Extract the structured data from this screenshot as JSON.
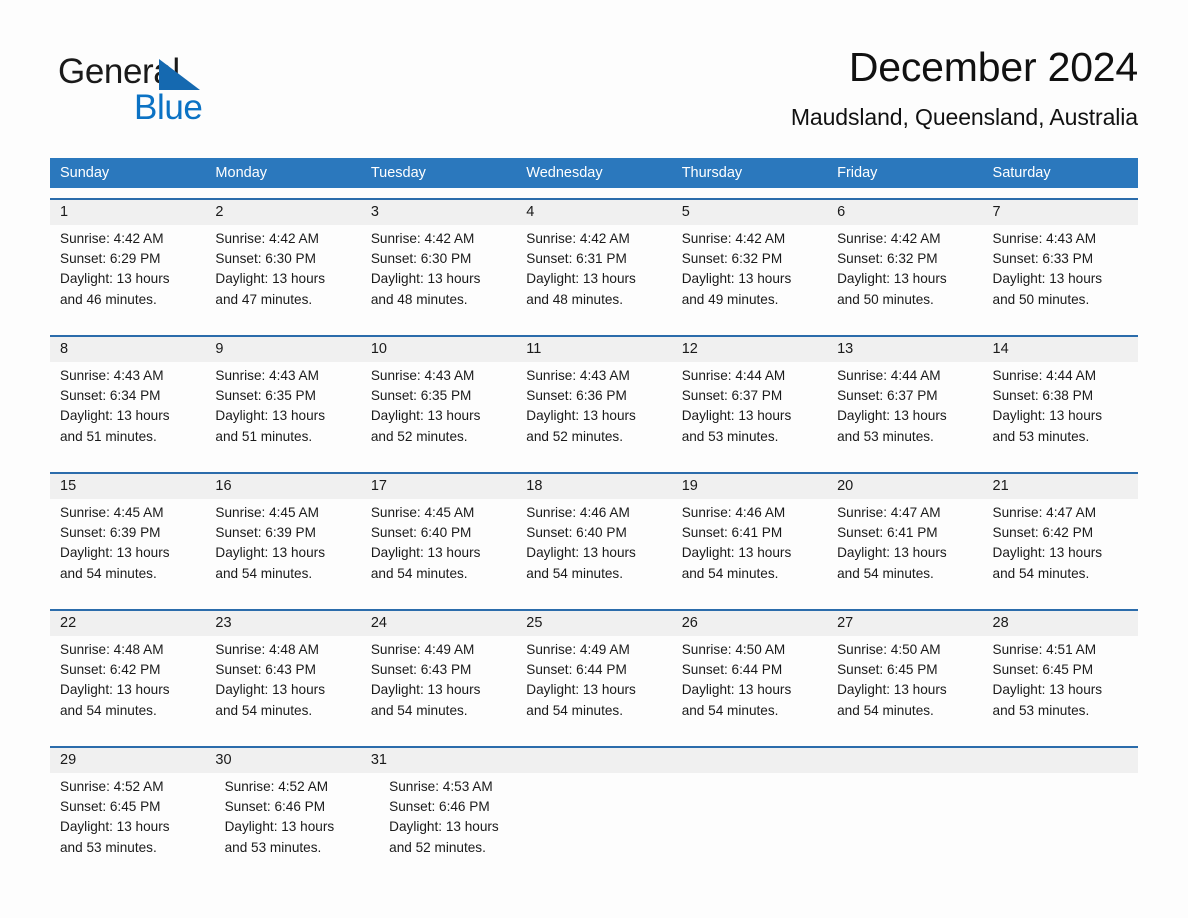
{
  "brand": {
    "name_part1": "General",
    "name_part2": "Blue",
    "triangle_color": "#1569b0",
    "blue_color": "#0b72c4"
  },
  "header": {
    "title": "December 2024",
    "location": "Maudsland, Queensland, Australia"
  },
  "theme": {
    "header_bg": "#2b78bd",
    "row_rule": "#2b6cab",
    "date_strip_bg": "#f0f0f0",
    "page_bg": "#fdfdfd",
    "text": "#1a1a1a"
  },
  "weekdays": [
    "Sunday",
    "Monday",
    "Tuesday",
    "Wednesday",
    "Thursday",
    "Friday",
    "Saturday"
  ],
  "weeks": [
    {
      "days": [
        {
          "date": "1",
          "l1": "Sunrise: 4:42 AM",
          "l2": "Sunset: 6:29 PM",
          "l3": "Daylight: 13 hours",
          "l4": "and 46 minutes."
        },
        {
          "date": "2",
          "l1": "Sunrise: 4:42 AM",
          "l2": "Sunset: 6:30 PM",
          "l3": "Daylight: 13 hours",
          "l4": "and 47 minutes."
        },
        {
          "date": "3",
          "l1": "Sunrise: 4:42 AM",
          "l2": "Sunset: 6:30 PM",
          "l3": "Daylight: 13 hours",
          "l4": "and 48 minutes."
        },
        {
          "date": "4",
          "l1": "Sunrise: 4:42 AM",
          "l2": "Sunset: 6:31 PM",
          "l3": "Daylight: 13 hours",
          "l4": "and 48 minutes."
        },
        {
          "date": "5",
          "l1": "Sunrise: 4:42 AM",
          "l2": "Sunset: 6:32 PM",
          "l3": "Daylight: 13 hours",
          "l4": "and 49 minutes."
        },
        {
          "date": "6",
          "l1": "Sunrise: 4:42 AM",
          "l2": "Sunset: 6:32 PM",
          "l3": "Daylight: 13 hours",
          "l4": "and 50 minutes."
        },
        {
          "date": "7",
          "l1": "Sunrise: 4:43 AM",
          "l2": "Sunset: 6:33 PM",
          "l3": "Daylight: 13 hours",
          "l4": "and 50 minutes."
        }
      ]
    },
    {
      "days": [
        {
          "date": "8",
          "l1": "Sunrise: 4:43 AM",
          "l2": "Sunset: 6:34 PM",
          "l3": "Daylight: 13 hours",
          "l4": "and 51 minutes."
        },
        {
          "date": "9",
          "l1": "Sunrise: 4:43 AM",
          "l2": "Sunset: 6:35 PM",
          "l3": "Daylight: 13 hours",
          "l4": "and 51 minutes."
        },
        {
          "date": "10",
          "l1": "Sunrise: 4:43 AM",
          "l2": "Sunset: 6:35 PM",
          "l3": "Daylight: 13 hours",
          "l4": "and 52 minutes."
        },
        {
          "date": "11",
          "l1": "Sunrise: 4:43 AM",
          "l2": "Sunset: 6:36 PM",
          "l3": "Daylight: 13 hours",
          "l4": "and 52 minutes."
        },
        {
          "date": "12",
          "l1": "Sunrise: 4:44 AM",
          "l2": "Sunset: 6:37 PM",
          "l3": "Daylight: 13 hours",
          "l4": "and 53 minutes."
        },
        {
          "date": "13",
          "l1": "Sunrise: 4:44 AM",
          "l2": "Sunset: 6:37 PM",
          "l3": "Daylight: 13 hours",
          "l4": "and 53 minutes."
        },
        {
          "date": "14",
          "l1": "Sunrise: 4:44 AM",
          "l2": "Sunset: 6:38 PM",
          "l3": "Daylight: 13 hours",
          "l4": "and 53 minutes."
        }
      ]
    },
    {
      "days": [
        {
          "date": "15",
          "l1": "Sunrise: 4:45 AM",
          "l2": "Sunset: 6:39 PM",
          "l3": "Daylight: 13 hours",
          "l4": "and 54 minutes."
        },
        {
          "date": "16",
          "l1": "Sunrise: 4:45 AM",
          "l2": "Sunset: 6:39 PM",
          "l3": "Daylight: 13 hours",
          "l4": "and 54 minutes."
        },
        {
          "date": "17",
          "l1": "Sunrise: 4:45 AM",
          "l2": "Sunset: 6:40 PM",
          "l3": "Daylight: 13 hours",
          "l4": "and 54 minutes."
        },
        {
          "date": "18",
          "l1": "Sunrise: 4:46 AM",
          "l2": "Sunset: 6:40 PM",
          "l3": "Daylight: 13 hours",
          "l4": "and 54 minutes."
        },
        {
          "date": "19",
          "l1": "Sunrise: 4:46 AM",
          "l2": "Sunset: 6:41 PM",
          "l3": "Daylight: 13 hours",
          "l4": "and 54 minutes."
        },
        {
          "date": "20",
          "l1": "Sunrise: 4:47 AM",
          "l2": "Sunset: 6:41 PM",
          "l3": "Daylight: 13 hours",
          "l4": "and 54 minutes."
        },
        {
          "date": "21",
          "l1": "Sunrise: 4:47 AM",
          "l2": "Sunset: 6:42 PM",
          "l3": "Daylight: 13 hours",
          "l4": "and 54 minutes."
        }
      ]
    },
    {
      "days": [
        {
          "date": "22",
          "l1": "Sunrise: 4:48 AM",
          "l2": "Sunset: 6:42 PM",
          "l3": "Daylight: 13 hours",
          "l4": "and 54 minutes."
        },
        {
          "date": "23",
          "l1": "Sunrise: 4:48 AM",
          "l2": "Sunset: 6:43 PM",
          "l3": "Daylight: 13 hours",
          "l4": "and 54 minutes."
        },
        {
          "date": "24",
          "l1": "Sunrise: 4:49 AM",
          "l2": "Sunset: 6:43 PM",
          "l3": "Daylight: 13 hours",
          "l4": "and 54 minutes."
        },
        {
          "date": "25",
          "l1": "Sunrise: 4:49 AM",
          "l2": "Sunset: 6:44 PM",
          "l3": "Daylight: 13 hours",
          "l4": "and 54 minutes."
        },
        {
          "date": "26",
          "l1": "Sunrise: 4:50 AM",
          "l2": "Sunset: 6:44 PM",
          "l3": "Daylight: 13 hours",
          "l4": "and 54 minutes."
        },
        {
          "date": "27",
          "l1": "Sunrise: 4:50 AM",
          "l2": "Sunset: 6:45 PM",
          "l3": "Daylight: 13 hours",
          "l4": "and 54 minutes."
        },
        {
          "date": "28",
          "l1": "Sunrise: 4:51 AM",
          "l2": "Sunset: 6:45 PM",
          "l3": "Daylight: 13 hours",
          "l4": "and 53 minutes."
        }
      ]
    },
    {
      "days": [
        {
          "date": "29",
          "l1": "Sunrise: 4:52 AM",
          "l2": "Sunset: 6:45 PM",
          "l3": "Daylight: 13 hours",
          "l4": "and 53 minutes."
        },
        {
          "date": "30",
          "l1": "Sunrise: 4:52 AM",
          "l2": "Sunset: 6:46 PM",
          "l3": "Daylight: 13 hours",
          "l4": "and 53 minutes."
        },
        {
          "date": "31",
          "l1": "Sunrise: 4:53 AM",
          "l2": "Sunset: 6:46 PM",
          "l3": "Daylight: 13 hours",
          "l4": "and 52 minutes."
        },
        {
          "date": "",
          "l1": "",
          "l2": "",
          "l3": "",
          "l4": ""
        },
        {
          "date": "",
          "l1": "",
          "l2": "",
          "l3": "",
          "l4": ""
        },
        {
          "date": "",
          "l1": "",
          "l2": "",
          "l3": "",
          "l4": ""
        },
        {
          "date": "",
          "l1": "",
          "l2": "",
          "l3": "",
          "l4": ""
        }
      ]
    }
  ]
}
